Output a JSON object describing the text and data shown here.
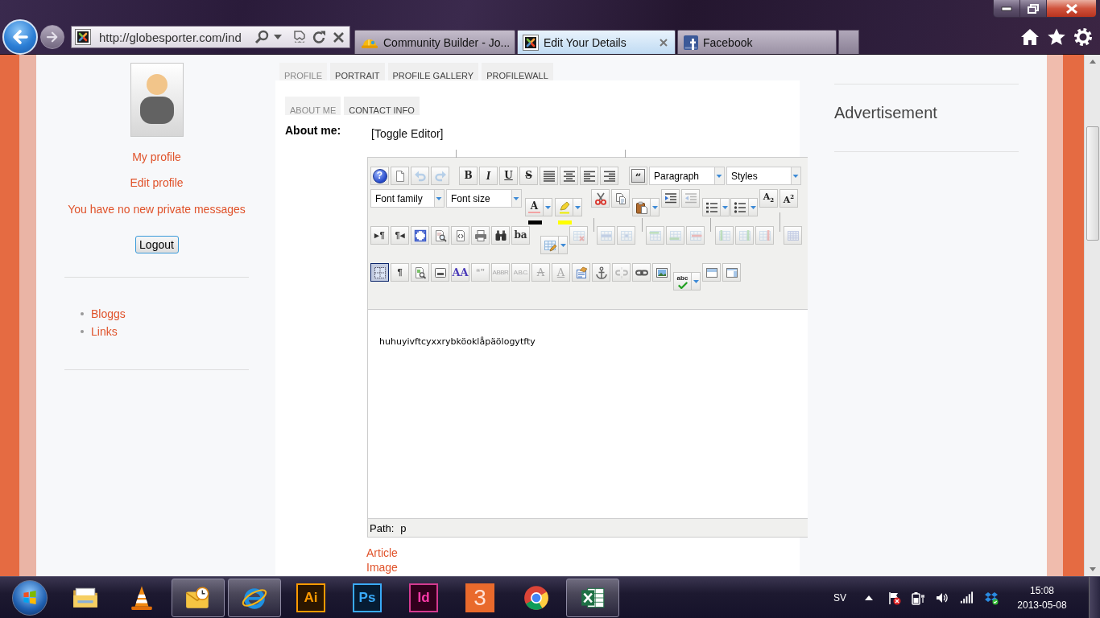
{
  "browser": {
    "address": "http://globesporter.com/ind",
    "tabs": [
      {
        "title": "Community Builder - Jo...",
        "selected": false
      },
      {
        "title": "Edit Your Details",
        "selected": true
      },
      {
        "title": "Facebook",
        "selected": false
      }
    ]
  },
  "sidebar": {
    "links": [
      "My profile",
      "Edit profile"
    ],
    "message": "You have no new private messages",
    "logout": "Logout",
    "menu": [
      "Bloggs",
      "Links"
    ]
  },
  "profile_tabs": [
    {
      "label": "PROFILE",
      "selected": true
    },
    {
      "label": "PORTRAIT",
      "selected": false
    },
    {
      "label": "PROFILE GALLERY",
      "selected": false
    },
    {
      "label": "PROFILEWALL",
      "selected": false
    }
  ],
  "section_tabs": [
    {
      "label": "ABOUT ME",
      "selected": true
    },
    {
      "label": "CONTACT INFO",
      "selected": false
    }
  ],
  "about_me": {
    "label": "About me:",
    "toggle": "[Toggle Editor]"
  },
  "editor": {
    "toolbar": [
      [
        {
          "kind": "button",
          "label": "?",
          "disabled": false,
          "active": false
        },
        {
          "kind": "button",
          "disabled": false,
          "active": false
        },
        {
          "kind": "button",
          "disabled": true,
          "active": false
        },
        {
          "kind": "button",
          "disabled": true,
          "active": false
        },
        {
          "kind": "button",
          "label": "B",
          "disabled": false,
          "active": false
        },
        {
          "kind": "button",
          "label": "I",
          "disabled": false,
          "active": false
        },
        {
          "kind": "button",
          "label": "U",
          "disabled": false,
          "active": false
        },
        {
          "kind": "button",
          "label": "S",
          "disabled": false,
          "active": false
        },
        {
          "kind": "button",
          "disabled": false,
          "active": false
        },
        {
          "kind": "button",
          "disabled": false,
          "active": false
        },
        {
          "kind": "button",
          "disabled": false,
          "active": false
        },
        {
          "kind": "button",
          "disabled": false,
          "active": false
        },
        {
          "kind": "button",
          "label": "“",
          "disabled": false,
          "active": false
        },
        {
          "kind": "select",
          "value": "Paragraph"
        },
        {
          "kind": "select",
          "value": "Styles"
        }
      ],
      [
        {
          "kind": "select",
          "value": "Font family"
        },
        {
          "kind": "select",
          "value": "Font size"
        },
        {
          "kind": "color",
          "label": "A",
          "color": "#000000",
          "disabled": false
        },
        {
          "kind": "color",
          "color": "#ffff00",
          "disabled": false
        },
        {
          "kind": "button",
          "disabled": false,
          "active": false
        },
        {
          "kind": "button",
          "disabled": false,
          "active": false
        },
        {
          "kind": "split",
          "disabled": false
        },
        {
          "kind": "button",
          "disabled": false,
          "active": false
        },
        {
          "kind": "button",
          "disabled": true,
          "active": false
        },
        {
          "kind": "split",
          "disabled": false
        },
        {
          "kind": "split",
          "disabled": false
        },
        {
          "kind": "button",
          "label": "A$_{2}$",
          "disabled": false,
          "active": false
        },
        {
          "kind": "button",
          "label": "A$^{2}$",
          "disabled": false,
          "active": false
        }
      ],
      [
        {
          "kind": "button",
          "label": "▸¶",
          "disabled": false,
          "active": false
        },
        {
          "kind": "button",
          "label": "¶◂",
          "disabled": false,
          "active": false
        },
        {
          "kind": "button",
          "disabled": false,
          "active": false
        },
        {
          "kind": "button",
          "disabled": false,
          "active": false
        },
        {
          "kind": "button",
          "disabled": false,
          "active": false
        },
        {
          "kind": "button",
          "disabled": false,
          "active": false
        },
        {
          "kind": "button",
          "disabled": false,
          "active": false
        },
        {
          "kind": "button",
          "label": "ba",
          "disabled": false,
          "active": false
        },
        {
          "kind": "split",
          "disabled": false
        },
        {
          "kind": "button",
          "disabled": true,
          "active": false
        },
        {
          "kind": "button",
          "disabled": true,
          "active": false
        },
        {
          "kind": "button",
          "disabled": true,
          "active": false
        },
        {
          "kind": "button",
          "disabled": true,
          "active": false
        },
        {
          "kind": "button",
          "disabled": true,
          "active": false
        },
        {
          "kind": "button",
          "disabled": true,
          "active": false
        },
        {
          "kind": "button",
          "disabled": true,
          "active": false
        },
        {
          "kind": "button",
          "disabled": true,
          "active": false
        },
        {
          "kind": "button",
          "disabled": true,
          "active": false
        },
        {
          "kind": "button",
          "disabled": true,
          "active": false
        }
      ],
      [
        {
          "kind": "button",
          "disabled": false,
          "active": true
        },
        {
          "kind": "button",
          "label": "¶",
          "disabled": false,
          "active": false
        },
        {
          "kind": "button",
          "disabled": false,
          "active": false
        },
        {
          "kind": "button",
          "disabled": false,
          "active": false
        },
        {
          "kind": "button",
          "label": "AA",
          "disabled": false,
          "active": false
        },
        {
          "kind": "button",
          "label": "“”",
          "disabled": true,
          "active": false
        },
        {
          "kind": "button",
          "label": "ABBR",
          "disabled": true,
          "active": false
        },
        {
          "kind": "button",
          "label": "A.B.C.",
          "disabled": true,
          "active": false
        },
        {
          "kind": "button",
          "label": "A",
          "disabled": true,
          "active": false
        },
        {
          "kind": "button",
          "label": "A",
          "disabled": true,
          "active": false
        },
        {
          "kind": "button",
          "disabled": false,
          "active": false
        },
        {
          "kind": "button",
          "disabled": false,
          "active": false
        },
        {
          "kind": "button",
          "disabled": true,
          "active": false
        },
        {
          "kind": "button",
          "disabled": false,
          "active": false
        },
        {
          "kind": "button",
          "disabled": false,
          "active": false
        },
        {
          "kind": "split",
          "label": "abc",
          "disabled": false
        },
        {
          "kind": "button",
          "disabled": false,
          "active": false
        },
        {
          "kind": "button",
          "disabled": false,
          "active": false
        }
      ]
    ],
    "text": "huhuyivftcyxxrybköoklåpäölogytfty",
    "path_label": "Path:",
    "path": "p"
  },
  "links": [
    "Article",
    "Image"
  ],
  "aside": {
    "heading": "Advertisement"
  },
  "taskbar": {
    "apps": [
      {
        "active": false
      },
      {
        "active": false
      },
      {
        "active": true
      },
      {
        "active": true
      },
      {
        "label": "Ai",
        "active": false
      },
      {
        "label": "Ps",
        "active": false
      },
      {
        "label": "Id",
        "active": false
      },
      {
        "label": "3",
        "active": false
      },
      {
        "active": false
      },
      {
        "active": true
      }
    ],
    "language": "SV",
    "time": "15:08",
    "date": "2013-05-08"
  }
}
